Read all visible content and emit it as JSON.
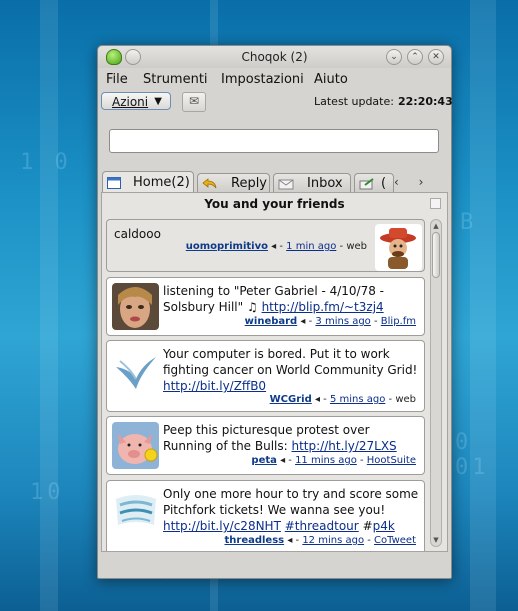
{
  "window": {
    "title": "Choqok (2)"
  },
  "menubar": {
    "items": [
      "File",
      "Strumenti",
      "Impostazioni",
      "Aiuto"
    ]
  },
  "toolbar": {
    "actions_label": "Azioni",
    "update_label": "Latest update:",
    "update_time": "22:20:43"
  },
  "status_input": {
    "value": "",
    "placeholder": ""
  },
  "tabs": [
    {
      "label": "Home(2)",
      "icon": "home-icon",
      "active": true
    },
    {
      "label": "Reply",
      "icon": "reply-icon",
      "active": false
    },
    {
      "label": "Inbox",
      "icon": "inbox-icon",
      "active": false
    },
    {
      "label": "(",
      "icon": "outbox-icon",
      "active": false
    }
  ],
  "timeline": {
    "title": "You and your friends",
    "posts": [
      {
        "text": "caldooo",
        "user": "uomoprimitivo",
        "time": "1 min ago",
        "source": "web",
        "source_is_link": false,
        "avatar": "cowboy-puppet-avatar"
      },
      {
        "text_plain": "listening to \"Peter Gabriel - 4/10/78 - Solsbury Hill\" ♫ ",
        "link": "http://blip.fm/~t3zj4",
        "user": "winebard",
        "time": "3 mins ago",
        "source": "Blip.fm",
        "source_is_link": true,
        "avatar": "woman-face-avatar"
      },
      {
        "text_plain": "Your computer is bored. Put it to work fighting cancer on World Community Grid! ",
        "link": "http://bit.ly/ZffB0",
        "user": "WCGrid",
        "time": "5 mins ago",
        "source": "web",
        "source_is_link": false,
        "avatar": "wcg-logo-avatar"
      },
      {
        "text_plain": "Peep this picturesque protest over Running of the Bulls: ",
        "link": "http://ht.ly/27LXS",
        "user": "peta",
        "time": "11 mins ago",
        "source": "HootSuite",
        "source_is_link": true,
        "avatar": "pig-avatar"
      },
      {
        "text_plain": "Only one more hour to try and score some Pitchfork tickets! We wanna see you! ",
        "link": "http://bit.ly/c28NHT",
        "tag1": "#threadtour",
        "tag2_prefix": "#",
        "tag2": "p4k",
        "user": "threadless",
        "time": "12 mins ago",
        "source": "CoTweet",
        "source_is_link": true,
        "avatar": "threadless-tweets-avatar"
      }
    ]
  },
  "colors": {
    "link": "#0b2e8c",
    "user": "#0e3a8a",
    "window_bg": "#d6d4d0",
    "desktop_bg": "#1a8fc4"
  }
}
